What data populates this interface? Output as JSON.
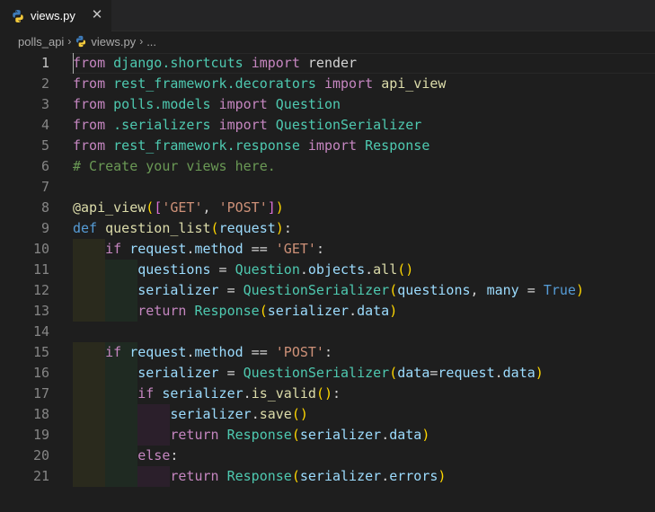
{
  "tab": {
    "filename": "views.py",
    "close_glyph": "✕",
    "icon": "python-icon"
  },
  "breadcrumb": {
    "folder": "polls_api",
    "file": "views.py",
    "more": "..."
  },
  "editor": {
    "active_line": 1,
    "line_numbers": [
      "1",
      "2",
      "3",
      "4",
      "5",
      "6",
      "7",
      "8",
      "9",
      "10",
      "11",
      "12",
      "13",
      "14",
      "15",
      "16",
      "17",
      "18",
      "19",
      "20",
      "21"
    ],
    "lines": [
      [
        [
          "kw",
          "from"
        ],
        [
          "plain",
          " "
        ],
        [
          "mod",
          "django.shortcuts"
        ],
        [
          "plain",
          " "
        ],
        [
          "kw",
          "import"
        ],
        [
          "plain",
          " render"
        ]
      ],
      [
        [
          "kw",
          "from"
        ],
        [
          "plain",
          " "
        ],
        [
          "mod",
          "rest_framework.decorators"
        ],
        [
          "plain",
          " "
        ],
        [
          "kw",
          "import"
        ],
        [
          "plain",
          " "
        ],
        [
          "fn",
          "api_view"
        ]
      ],
      [
        [
          "kw",
          "from"
        ],
        [
          "plain",
          " "
        ],
        [
          "mod",
          "polls.models"
        ],
        [
          "plain",
          " "
        ],
        [
          "kw",
          "import"
        ],
        [
          "plain",
          " "
        ],
        [
          "cls",
          "Question"
        ]
      ],
      [
        [
          "kw",
          "from"
        ],
        [
          "plain",
          " "
        ],
        [
          "mod",
          ".serializers"
        ],
        [
          "plain",
          " "
        ],
        [
          "kw",
          "import"
        ],
        [
          "plain",
          " "
        ],
        [
          "cls",
          "QuestionSerializer"
        ]
      ],
      [
        [
          "kw",
          "from"
        ],
        [
          "plain",
          " "
        ],
        [
          "mod",
          "rest_framework.response"
        ],
        [
          "plain",
          " "
        ],
        [
          "kw",
          "import"
        ],
        [
          "plain",
          " "
        ],
        [
          "cls",
          "Response"
        ]
      ],
      [
        [
          "cmt",
          "# Create your views here."
        ]
      ],
      [],
      [
        [
          "fn",
          "@api_view"
        ],
        [
          "p1",
          "("
        ],
        [
          "p2",
          "["
        ],
        [
          "str",
          "'GET'"
        ],
        [
          "plain",
          ", "
        ],
        [
          "str",
          "'POST'"
        ],
        [
          "p2",
          "]"
        ],
        [
          "p1",
          ")"
        ]
      ],
      [
        [
          "kwb",
          "def"
        ],
        [
          "plain",
          " "
        ],
        [
          "fn",
          "question_list"
        ],
        [
          "p1",
          "("
        ],
        [
          "var",
          "request"
        ],
        [
          "p1",
          ")"
        ],
        [
          "plain",
          ":"
        ]
      ],
      [
        [
          "plain",
          "    "
        ],
        [
          "kw",
          "if"
        ],
        [
          "plain",
          " "
        ],
        [
          "var",
          "request"
        ],
        [
          "plain",
          "."
        ],
        [
          "var",
          "method"
        ],
        [
          "plain",
          " == "
        ],
        [
          "str",
          "'GET'"
        ],
        [
          "plain",
          ":"
        ]
      ],
      [
        [
          "plain",
          "        "
        ],
        [
          "var",
          "questions"
        ],
        [
          "plain",
          " = "
        ],
        [
          "cls",
          "Question"
        ],
        [
          "plain",
          "."
        ],
        [
          "var",
          "objects"
        ],
        [
          "plain",
          "."
        ],
        [
          "fn",
          "all"
        ],
        [
          "p1",
          "()"
        ]
      ],
      [
        [
          "plain",
          "        "
        ],
        [
          "var",
          "serializer"
        ],
        [
          "plain",
          " = "
        ],
        [
          "cls",
          "QuestionSerializer"
        ],
        [
          "p1",
          "("
        ],
        [
          "var",
          "questions"
        ],
        [
          "plain",
          ", "
        ],
        [
          "var",
          "many"
        ],
        [
          "plain",
          " = "
        ],
        [
          "const",
          "True"
        ],
        [
          "p1",
          ")"
        ]
      ],
      [
        [
          "plain",
          "        "
        ],
        [
          "kw",
          "return"
        ],
        [
          "plain",
          " "
        ],
        [
          "cls",
          "Response"
        ],
        [
          "p1",
          "("
        ],
        [
          "var",
          "serializer"
        ],
        [
          "plain",
          "."
        ],
        [
          "var",
          "data"
        ],
        [
          "p1",
          ")"
        ]
      ],
      [],
      [
        [
          "plain",
          "    "
        ],
        [
          "kw",
          "if"
        ],
        [
          "plain",
          " "
        ],
        [
          "var",
          "request"
        ],
        [
          "plain",
          "."
        ],
        [
          "var",
          "method"
        ],
        [
          "plain",
          " == "
        ],
        [
          "str",
          "'POST'"
        ],
        [
          "plain",
          ":"
        ]
      ],
      [
        [
          "plain",
          "        "
        ],
        [
          "var",
          "serializer"
        ],
        [
          "plain",
          " = "
        ],
        [
          "cls",
          "QuestionSerializer"
        ],
        [
          "p1",
          "("
        ],
        [
          "var",
          "data"
        ],
        [
          "plain",
          "="
        ],
        [
          "var",
          "request"
        ],
        [
          "plain",
          "."
        ],
        [
          "var",
          "data"
        ],
        [
          "p1",
          ")"
        ]
      ],
      [
        [
          "plain",
          "        "
        ],
        [
          "kw",
          "if"
        ],
        [
          "plain",
          " "
        ],
        [
          "var",
          "serializer"
        ],
        [
          "plain",
          "."
        ],
        [
          "fn",
          "is_valid"
        ],
        [
          "p1",
          "()"
        ],
        [
          "plain",
          ":"
        ]
      ],
      [
        [
          "plain",
          "            "
        ],
        [
          "var",
          "serializer"
        ],
        [
          "plain",
          "."
        ],
        [
          "fn",
          "save"
        ],
        [
          "p1",
          "()"
        ]
      ],
      [
        [
          "plain",
          "            "
        ],
        [
          "kw",
          "return"
        ],
        [
          "plain",
          " "
        ],
        [
          "cls",
          "Response"
        ],
        [
          "p1",
          "("
        ],
        [
          "var",
          "serializer"
        ],
        [
          "plain",
          "."
        ],
        [
          "var",
          "data"
        ],
        [
          "p1",
          ")"
        ]
      ],
      [
        [
          "plain",
          "        "
        ],
        [
          "kw",
          "else"
        ],
        [
          "plain",
          ":"
        ]
      ],
      [
        [
          "plain",
          "            "
        ],
        [
          "kw",
          "return"
        ],
        [
          "plain",
          " "
        ],
        [
          "cls",
          "Response"
        ],
        [
          "p1",
          "("
        ],
        [
          "var",
          "serializer"
        ],
        [
          "plain",
          "."
        ],
        [
          "var",
          "errors"
        ],
        [
          "p1",
          ")"
        ]
      ]
    ]
  }
}
